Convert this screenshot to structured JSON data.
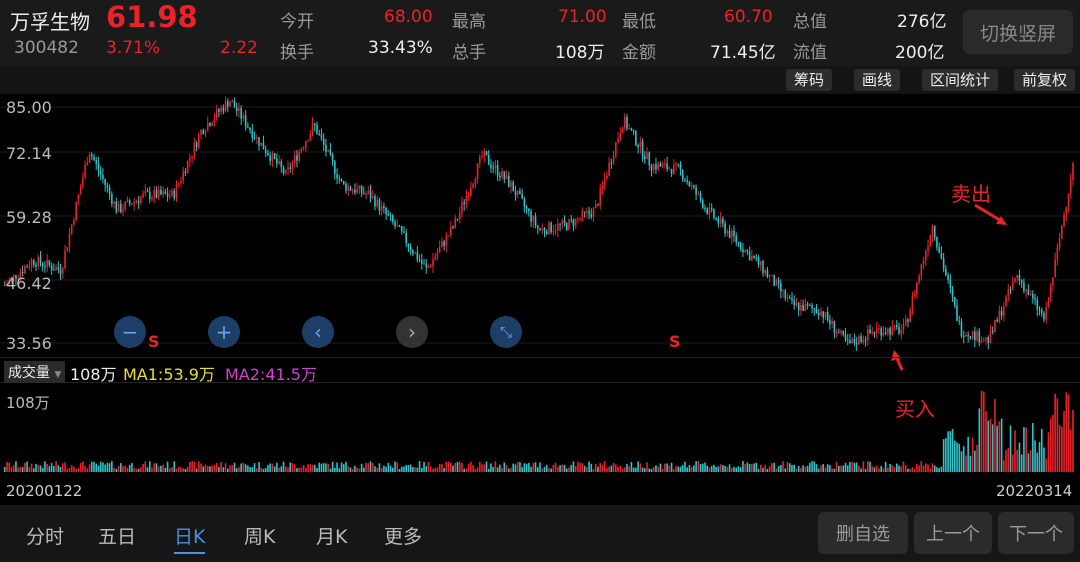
{
  "header": {
    "name": "万孚生物",
    "price": "61.98",
    "code": "300482",
    "change_pct": "3.71%",
    "change": "2.22",
    "open_label": "今开",
    "open": "68.00",
    "high_label": "最高",
    "high": "71.00",
    "low_label": "最低",
    "low": "60.70",
    "mcap_label": "总值",
    "mcap": "276亿",
    "turnover_label": "换手",
    "turnover": "33.43%",
    "vol_label": "总手",
    "vol": "108万",
    "amount_label": "金额",
    "amount": "71.45亿",
    "float_label": "流值",
    "float": "200亿",
    "switch_btn": "切换竖屏"
  },
  "toolbar": [
    "筹码",
    "画线",
    "区间统计",
    "前复权"
  ],
  "y_axis": [
    "85.00",
    "72.14",
    "59.28",
    "46.42",
    "33.56"
  ],
  "signals": {
    "s": "S",
    "sell": "卖出",
    "buy": "买入"
  },
  "volume": {
    "selector": "成交量",
    "value": "108万",
    "ma1": "MA1:53.9万",
    "ma2": "MA2:41.5万",
    "max": "108万"
  },
  "dates": {
    "start": "20200122",
    "end": "20220314"
  },
  "tabs": [
    "分时",
    "五日",
    "日K",
    "周K",
    "月K",
    "更多"
  ],
  "buttons": {
    "remove": "删自选",
    "prev": "上一个",
    "next": "下一个"
  },
  "colors": {
    "up": "#e8232a",
    "down": "#2ec4c9",
    "ma1": "#e6e02c",
    "ma2": "#d43fd4"
  },
  "chart_data": {
    "type": "candlestick",
    "ylim": [
      33.56,
      85.0
    ],
    "close_keypoints": [
      46.2,
      51.6,
      49.5,
      75.6,
      62.5,
      65.8,
      65.8,
      80,
      86.5,
      77.8,
      70.2,
      81.1,
      68,
      65.8,
      58.2,
      49.5,
      59.3,
      74.5,
      68,
      58.2,
      59.3,
      62.5,
      82.2,
      72.4,
      71.3,
      62.5,
      56,
      49.5,
      41.8,
      40.7,
      33.1,
      36.4,
      36.4,
      59.3,
      36.4,
      34.2,
      48.4,
      38.6,
      72.4
    ]
  }
}
